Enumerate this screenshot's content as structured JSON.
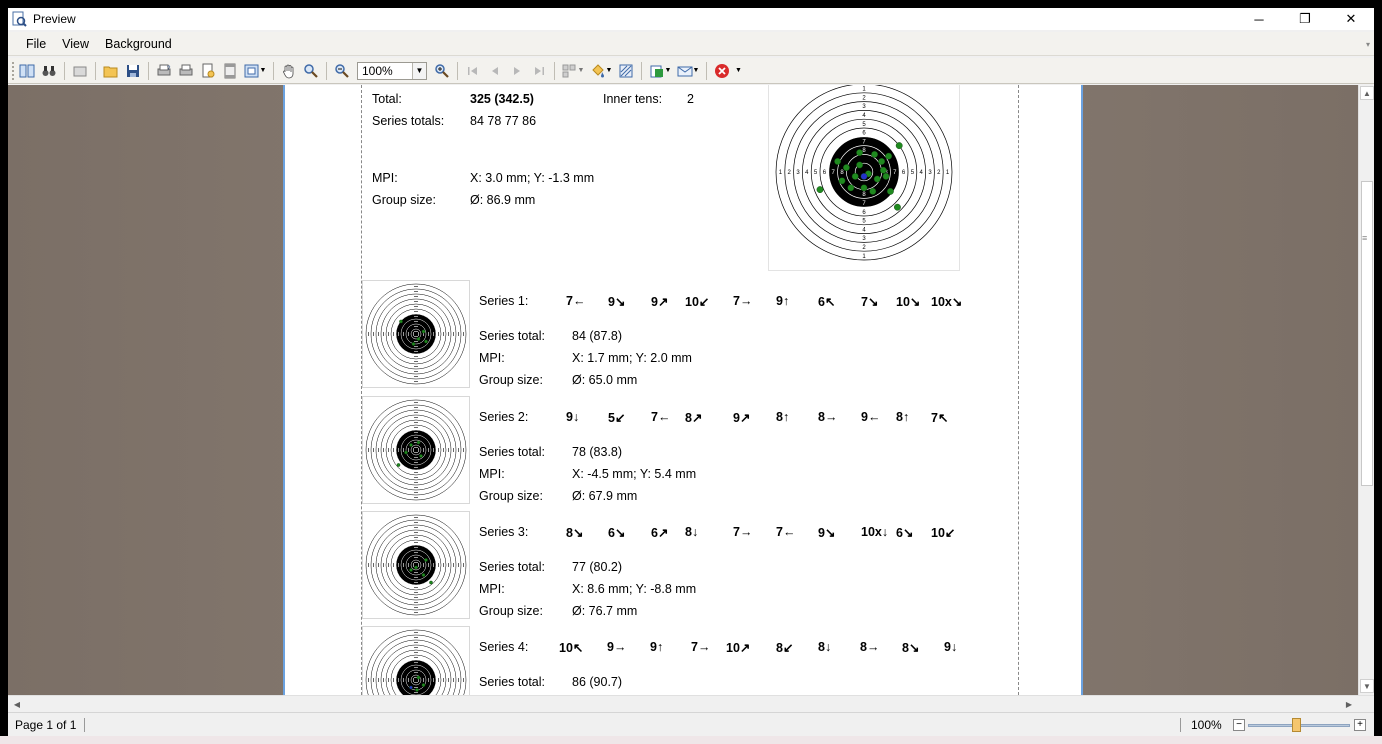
{
  "window": {
    "title": "Preview"
  },
  "menu": [
    "File",
    "View",
    "Background"
  ],
  "toolbar": {
    "zoom_value": "100%"
  },
  "status": {
    "page": "Page 1 of 1",
    "zoom": "100%"
  },
  "colors": {
    "page_border": "#6ba2e0",
    "background": "#897d73",
    "hit_green": "#1f8a1f",
    "hit_blue": "#2433c9"
  },
  "summary": {
    "total_label": "Total:",
    "total_value": "325 (342.5)",
    "inner_tens_label": "Inner tens:",
    "inner_tens_value": "2",
    "series_totals_label": "Series totals:",
    "series_totals_value": "84 78 77 86",
    "mpi_label": "MPI:",
    "mpi_value": "X: 3.0 mm; Y: -1.3 mm",
    "group_label": "Group size:",
    "group_value": "Ø: 86.9 mm"
  },
  "series": [
    {
      "label": "Series 1:",
      "shots": [
        "7←",
        "9↘",
        "9↗",
        "10↙",
        "7→",
        "9↑",
        "6↖",
        "7↘",
        "10↘",
        "10x↘"
      ],
      "total_label": "Series total:",
      "total": "84 (87.8)",
      "mpi_label": "MPI:",
      "mpi": "X: 1.7 mm; Y: 2.0 mm",
      "group_label": "Group size:",
      "group": "Ø: 65.0 mm"
    },
    {
      "label": "Series 2:",
      "shots": [
        "9↓",
        "5↙",
        "7←",
        "8↗",
        "9↗",
        "8↑",
        "8→",
        "9←",
        "8↑",
        "7↖"
      ],
      "total_label": "Series total:",
      "total": "78 (83.8)",
      "mpi_label": "MPI:",
      "mpi": "X: -4.5 mm; Y: 5.4 mm",
      "group_label": "Group size:",
      "group": "Ø: 67.9 mm"
    },
    {
      "label": "Series 3:",
      "shots": [
        "8↘",
        "6↘",
        "6↗",
        "8↓",
        "7→",
        "7←",
        "9↘",
        "10x↓",
        "6↘",
        "10↙"
      ],
      "total_label": "Series total:",
      "total": "77 (80.2)",
      "mpi_label": "MPI:",
      "mpi": "X: 8.6 mm; Y: -8.8 mm",
      "group_label": "Group size:",
      "group": "Ø: 76.7 mm"
    },
    {
      "label": "Series 4:",
      "shots": [
        "10↖",
        "9→",
        "9↑",
        "7→",
        "10↗",
        "8↙",
        "8↓",
        "8→",
        "8↘",
        "9↓"
      ],
      "total_label": "Series total:",
      "total": "86 (90.7)"
    }
  ]
}
